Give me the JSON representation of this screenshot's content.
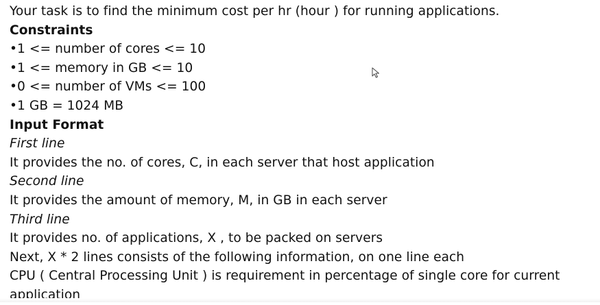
{
  "lines": [
    {
      "text": "Your task is to find the minimum cost per hr (hour ) for running applications."
    },
    {
      "text": "Constraints"
    },
    {
      "text": "•1 <= number of cores <= 10"
    },
    {
      "text": "•1 <= memory in GB <= 10"
    },
    {
      "text": "•0 <= number of VMs <= 100"
    },
    {
      "text": "•1 GB = 1024 MB"
    },
    {
      "text": "Input Format"
    },
    {
      "text": "First line"
    },
    {
      "text": "It  provides the no. of cores, C, in each server that host application"
    },
    {
      "text": "Second line"
    },
    {
      "text": "It provides the amount of memory, M, in GB in each server"
    },
    {
      "text": "Third line"
    },
    {
      "text": "It provides no. of applications, X , to be packed on servers"
    },
    {
      "text": "Next, X * 2 lines consists of the following information, on one line each"
    },
    {
      "text": "CPU  ( Central Processing Unit ) is requirement in percentage of single core for current application"
    }
  ],
  "cursor": {
    "icon": "mouse-pointer-icon"
  }
}
